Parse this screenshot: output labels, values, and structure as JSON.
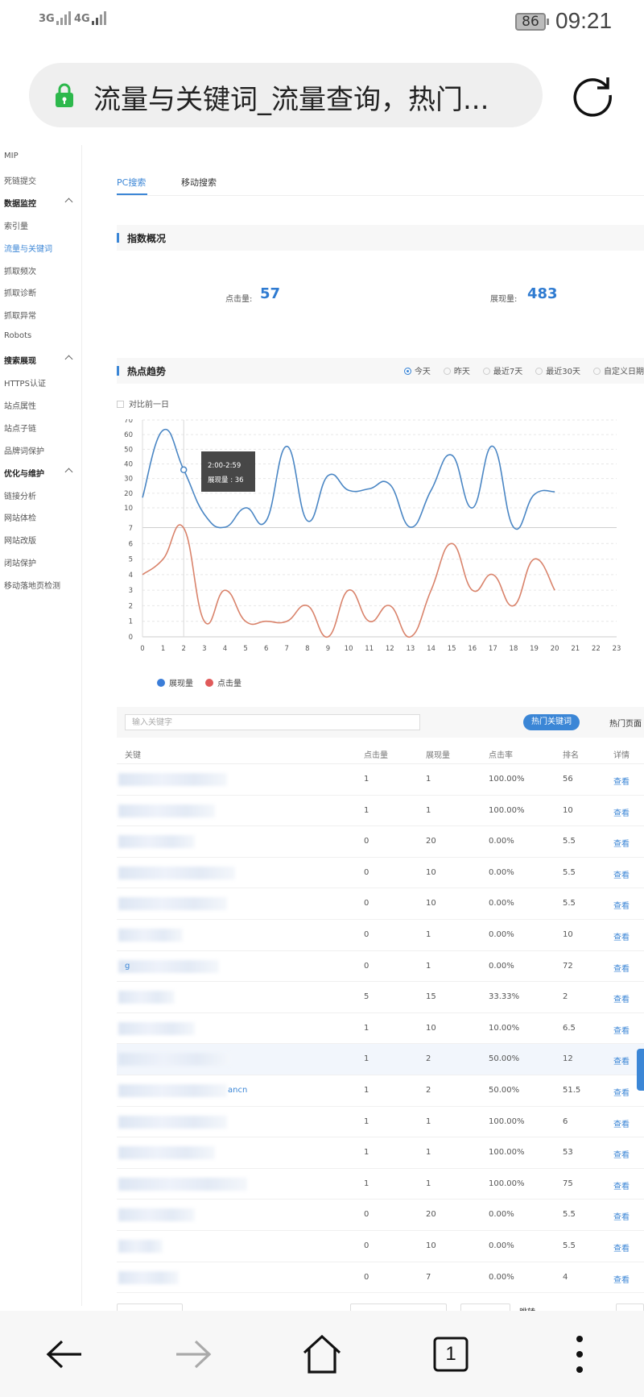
{
  "status": {
    "network1": "3G",
    "network2": "4G",
    "battery": "86",
    "time": "09:21"
  },
  "browser": {
    "url_text": "流量与关键词_流量查询，热门...",
    "tab_count": "1"
  },
  "sidebar": {
    "items": [
      {
        "label": "MIP",
        "type": "item"
      },
      {
        "label": "死链提交",
        "type": "item"
      },
      {
        "label": "数据监控",
        "type": "head"
      },
      {
        "label": "索引量",
        "type": "item"
      },
      {
        "label": "流量与关键词",
        "type": "item",
        "active": true
      },
      {
        "label": "抓取频次",
        "type": "item"
      },
      {
        "label": "抓取诊断",
        "type": "item"
      },
      {
        "label": "抓取异常",
        "type": "item"
      },
      {
        "label": "Robots",
        "type": "item"
      },
      {
        "label": "搜索展现",
        "type": "head"
      },
      {
        "label": "HTTPS认证",
        "type": "item"
      },
      {
        "label": "站点属性",
        "type": "item"
      },
      {
        "label": "站点子链",
        "type": "item"
      },
      {
        "label": "品牌词保护",
        "type": "item"
      },
      {
        "label": "优化与维护",
        "type": "head"
      },
      {
        "label": "链接分析",
        "type": "item"
      },
      {
        "label": "网站体检",
        "type": "item"
      },
      {
        "label": "网站改版",
        "type": "item"
      },
      {
        "label": "闭站保护",
        "type": "item"
      },
      {
        "label": "移动落地页检测",
        "type": "item"
      }
    ]
  },
  "tabs": {
    "pc": "PC搜索",
    "mobile": "移动搜索"
  },
  "overview": {
    "title": "指数概况",
    "clicks_label": "点击量:",
    "clicks_value": "57",
    "impressions_label": "展现量:",
    "impressions_value": "483"
  },
  "trend": {
    "title": "热点趋势",
    "ranges": [
      "今天",
      "昨天",
      "最近7天",
      "最近30天",
      "自定义日期"
    ],
    "selected_range": "今天",
    "compare_label": "对比前一日",
    "tooltip_time": "2:00-2:59",
    "tooltip_value": "展现量 : 36"
  },
  "chart_data": {
    "type": "line",
    "x": [
      0,
      1,
      2,
      3,
      4,
      5,
      6,
      7,
      8,
      9,
      10,
      11,
      12,
      13,
      14,
      15,
      16,
      17,
      18,
      19,
      20
    ],
    "x_ticks": [
      "0",
      "1",
      "2",
      "3",
      "4",
      "5",
      "6",
      "7",
      "8",
      "9",
      "10",
      "11",
      "12",
      "13",
      "14",
      "15",
      "16",
      "17",
      "18",
      "19",
      "20",
      "21",
      "22",
      "23"
    ],
    "series": [
      {
        "name": "展现量",
        "color": "#4a86c4",
        "values": [
          17,
          63,
          36,
          9,
          7,
          10,
          8,
          52,
          8,
          32,
          22,
          23,
          26,
          7,
          22,
          46,
          10,
          52,
          7,
          19,
          21
        ]
      },
      {
        "name": "点击量",
        "color": "#d9836b",
        "values": [
          4,
          5,
          7,
          1,
          3,
          1,
          1,
          1,
          2,
          0,
          3,
          1,
          2,
          0,
          3,
          6,
          3,
          4,
          2,
          5,
          3
        ]
      }
    ],
    "top_ylim": [
      7,
      70
    ],
    "top_yticks": [
      7,
      10,
      20,
      30,
      40,
      50,
      60,
      70
    ],
    "bottom_ylim": [
      0,
      7
    ],
    "bottom_yticks": [
      0,
      1,
      2,
      3,
      4,
      5,
      6,
      7
    ],
    "grid": true,
    "legend": "bottom-left"
  },
  "legend": {
    "impressions": "展现量",
    "clicks": "点击量",
    "impressions_color": "#3b7dd8",
    "clicks_color": "#e05a5a"
  },
  "table": {
    "search_placeholder": "输入关键字",
    "hot_keywords_btn": "热门关键词",
    "hot_pages_btn": "热门页面",
    "headers": {
      "keyword": "关键",
      "clicks": "点击量",
      "impressions": "展现量",
      "ctr": "点击率",
      "rank": "排名",
      "detail": "详情"
    },
    "rows": [
      {
        "kw": "",
        "clicks": "1",
        "impr": "1",
        "ctr": "100.00%",
        "rank": "56",
        "detail": "查看",
        "bw": 135
      },
      {
        "kw": "",
        "clicks": "1",
        "impr": "1",
        "ctr": "100.00%",
        "rank": "10",
        "detail": "查看",
        "bw": 120
      },
      {
        "kw": "",
        "clicks": "0",
        "impr": "20",
        "ctr": "0.00%",
        "rank": "5.5",
        "detail": "查看",
        "bw": 95
      },
      {
        "kw": "",
        "clicks": "0",
        "impr": "10",
        "ctr": "0.00%",
        "rank": "5.5",
        "detail": "查看",
        "bw": 145
      },
      {
        "kw": "",
        "clicks": "0",
        "impr": "10",
        "ctr": "0.00%",
        "rank": "5.5",
        "detail": "查看",
        "bw": 135
      },
      {
        "kw": "",
        "clicks": "0",
        "impr": "1",
        "ctr": "0.00%",
        "rank": "10",
        "detail": "查看",
        "bw": 80
      },
      {
        "kw": "g",
        "clicks": "0",
        "impr": "1",
        "ctr": "0.00%",
        "rank": "72",
        "detail": "查看",
        "bw": 125
      },
      {
        "kw": "",
        "clicks": "5",
        "impr": "15",
        "ctr": "33.33%",
        "rank": "2",
        "detail": "查看",
        "bw": 70
      },
      {
        "kw": "",
        "clicks": "1",
        "impr": "10",
        "ctr": "10.00%",
        "rank": "6.5",
        "detail": "查看",
        "bw": 95
      },
      {
        "kw": "",
        "clicks": "1",
        "impr": "2",
        "ctr": "50.00%",
        "rank": "12",
        "detail": "查看",
        "bw": 140,
        "highlight": true
      },
      {
        "kw": "ancn",
        "clicks": "1",
        "impr": "2",
        "ctr": "50.00%",
        "rank": "51.5",
        "detail": "查看",
        "bw": 135
      },
      {
        "kw": "",
        "clicks": "1",
        "impr": "1",
        "ctr": "100.00%",
        "rank": "6",
        "detail": "查看",
        "bw": 135
      },
      {
        "kw": "",
        "clicks": "1",
        "impr": "1",
        "ctr": "100.00%",
        "rank": "53",
        "detail": "查看",
        "bw": 120
      },
      {
        "kw": "",
        "clicks": "1",
        "impr": "1",
        "ctr": "100.00%",
        "rank": "75",
        "detail": "查看",
        "bw": 160
      },
      {
        "kw": "",
        "clicks": "0",
        "impr": "20",
        "ctr": "0.00%",
        "rank": "5.5",
        "detail": "查看",
        "bw": 95
      },
      {
        "kw": "",
        "clicks": "0",
        "impr": "10",
        "ctr": "0.00%",
        "rank": "5.5",
        "detail": "查看",
        "bw": 55
      },
      {
        "kw": "",
        "clicks": "0",
        "impr": "7",
        "ctr": "0.00%",
        "rank": "4",
        "detail": "查看",
        "bw": 75
      }
    ]
  },
  "pager": {
    "jump_label": "跳转"
  }
}
